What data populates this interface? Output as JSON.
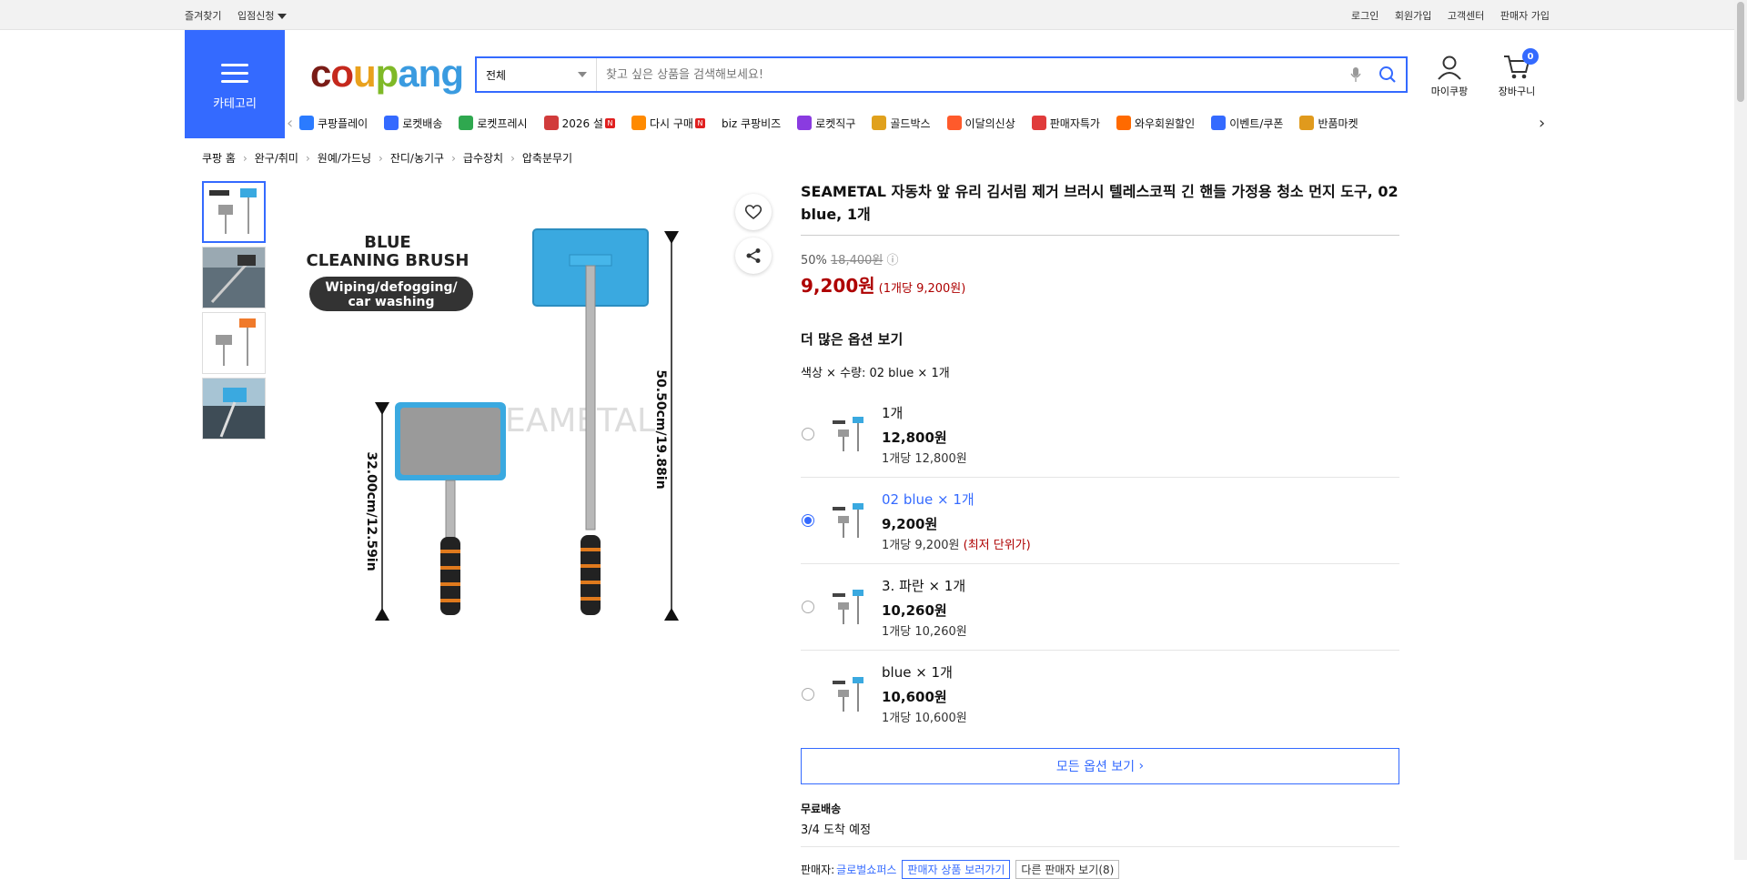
{
  "topbar": {
    "left": [
      "즐겨찾기",
      "입점신청"
    ],
    "right": [
      "로그인",
      "회원가입",
      "고객센터",
      "판매자 가입"
    ]
  },
  "header": {
    "category_label": "카테고리",
    "logo": [
      "c",
      "o",
      "u",
      "p",
      "ang"
    ],
    "search_category": "전체",
    "search_placeholder": "찾고 싶은 상품을 검색해보세요!",
    "mypage_label": "마이쿠팡",
    "cart_label": "장바구니",
    "cart_count": "0"
  },
  "nav": [
    {
      "label": "쿠팡플레이",
      "color": "#2b7bff",
      "badge": ""
    },
    {
      "label": "로켓배송",
      "color": "#346aff",
      "badge": ""
    },
    {
      "label": "로켓프레시",
      "color": "#2fa84f",
      "badge": ""
    },
    {
      "label": "2026 설",
      "color": "#d13b3b",
      "badge": "N"
    },
    {
      "label": "다시 구매",
      "color": "#ff8a00",
      "badge": "N"
    },
    {
      "label": "biz 쿠팡비즈",
      "color": "#ffffff",
      "badge": ""
    },
    {
      "label": "로켓직구",
      "color": "#8a3be0",
      "badge": ""
    },
    {
      "label": "골드박스",
      "color": "#e0a11d",
      "badge": ""
    },
    {
      "label": "이달의신상",
      "color": "#ff5a2b",
      "badge": ""
    },
    {
      "label": "판매자특가",
      "color": "#e03b3b",
      "badge": ""
    },
    {
      "label": "와우회원할인",
      "color": "#ff6a00",
      "badge": ""
    },
    {
      "label": "이벤트/쿠폰",
      "color": "#346aff",
      "badge": ""
    },
    {
      "label": "반품마켓",
      "color": "#e09a1d",
      "badge": ""
    }
  ],
  "breadcrumb": [
    "쿠팡 홈",
    "완구/취미",
    "원예/가드닝",
    "잔디/농기구",
    "급수장치",
    "압축분무기"
  ],
  "image": {
    "title_line1": "BLUE",
    "title_line2": "CLEANING BRUSH",
    "pill_line1": "Wiping/defogging/",
    "pill_line2": "car washing",
    "dim_long": "50.50cm/19.88in",
    "dim_short": "32.00cm/12.59in",
    "watermark": "EAMETAL"
  },
  "product": {
    "title": "SEAMETAL 자동차 앞 유리 김서림 제거 브러시 텔레스코픽 긴 핸들 가정용 청소 먼지 도구, 02 blue, 1개",
    "discount": "50%",
    "original_price": "18,400원",
    "sale_price": "9,200원",
    "unit_price": "(1개당 9,200원)"
  },
  "options": {
    "heading": "더 많은 옵션 보기",
    "summary": "색상 × 수량: 02 blue × 1개",
    "items": [
      {
        "name": "1개",
        "price": "12,800원",
        "unit": "1개당 12,800원",
        "note": ""
      },
      {
        "name": "02 blue × 1개",
        "price": "9,200원",
        "unit": "1개당 9,200원",
        "note": "(최저 단위가)"
      },
      {
        "name": "3. 파란 × 1개",
        "price": "10,260원",
        "unit": "1개당 10,260원",
        "note": ""
      },
      {
        "name": "blue × 1개",
        "price": "10,600원",
        "unit": "1개당 10,600원",
        "note": ""
      }
    ],
    "all_button": "모든 옵션 보기"
  },
  "delivery": {
    "free": "무료배송",
    "eta": "3/4 도착 예정"
  },
  "seller": {
    "label": "판매자:",
    "name": "글로벌쇼퍼스",
    "view_products": "판매자 상품 보러가기",
    "other_sellers": "다른 판매자 보기(8)"
  }
}
